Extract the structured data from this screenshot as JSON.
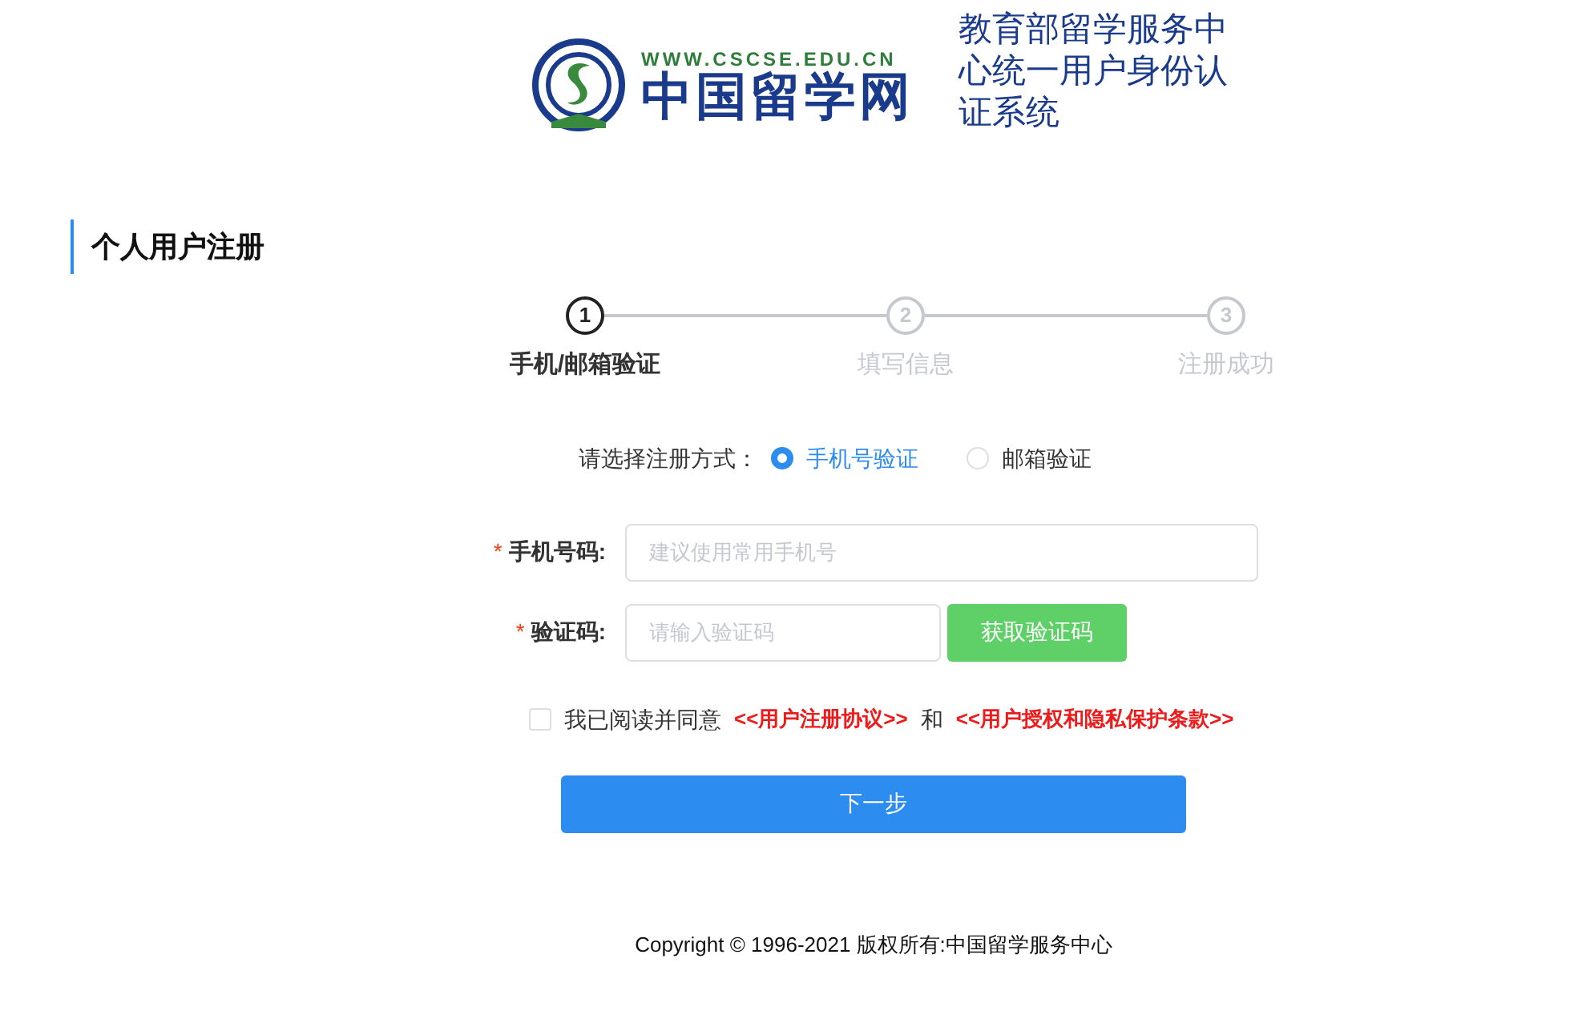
{
  "header": {
    "logo_url": "WWW.CSCSE.EDU.CN",
    "logo_name": "中国留学网",
    "title": "教育部留学服务中心统一用户身份认证系统"
  },
  "page_title": "个人用户注册",
  "steps": [
    {
      "number": "1",
      "label": "手机/邮箱验证",
      "selected": true
    },
    {
      "number": "2",
      "label": "填写信息",
      "selected": false
    },
    {
      "number": "3",
      "label": "注册成功",
      "selected": false
    }
  ],
  "method": {
    "label": "请选择注册方式：",
    "options": [
      {
        "label": "手机号验证",
        "selected": true
      },
      {
        "label": "邮箱验证",
        "selected": false
      }
    ]
  },
  "fields": [
    {
      "kind": "text",
      "required_mark": "*",
      "label": "手机号码:",
      "placeholder": "建议使用常用手机号"
    },
    {
      "kind": "code",
      "required_mark": "*",
      "label": "验证码:",
      "placeholder": "请输入验证码",
      "button": "获取验证码"
    }
  ],
  "agreement": {
    "checked": false,
    "text": "我已阅读并同意",
    "links": [
      "<<用户注册协议>>",
      "<<用户授权和隐私保护条款>>"
    ],
    "joiner": "和"
  },
  "next_button": "下一步",
  "footer": "Copyright © 1996-2021 版权所有:中国留学服务中心"
}
